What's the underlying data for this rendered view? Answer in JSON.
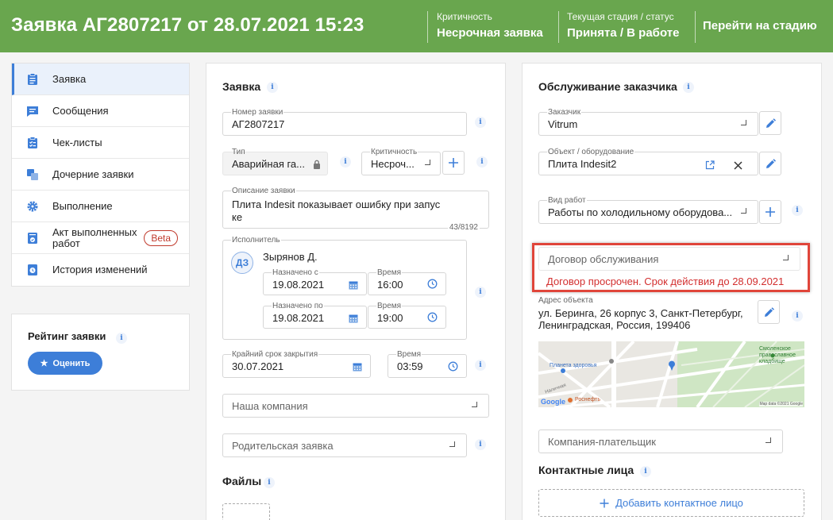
{
  "header": {
    "title": "Заявка АГ2807217 от 28.07.2021 15:23",
    "criticality_label": "Критичность",
    "criticality_value": "Несрочная заявка",
    "stage_label": "Текущая стадия / статус",
    "stage_value": "Принята / В работе",
    "goto_stage": "Перейти на стадию"
  },
  "sidebar": {
    "items": [
      {
        "label": "Заявка",
        "icon": "clipboard-icon"
      },
      {
        "label": "Сообщения",
        "icon": "message-icon"
      },
      {
        "label": "Чек-листы",
        "icon": "checklist-icon"
      },
      {
        "label": "Дочерние заявки",
        "icon": "child-requests-icon"
      },
      {
        "label": "Выполнение",
        "icon": "gear-icon"
      },
      {
        "label": "Акт выполненных работ",
        "icon": "act-icon",
        "badge": "Beta"
      },
      {
        "label": "История изменений",
        "icon": "history-icon"
      }
    ]
  },
  "rating": {
    "title": "Рейтинг заявки",
    "button": "Оценить"
  },
  "request": {
    "title": "Заявка",
    "number_label": "Номер заявки",
    "number_value": "АГ2807217",
    "type_label": "Тип",
    "type_value": "Аварийная га...",
    "crit_label": "Критичность",
    "crit_value": "Несроч...",
    "desc_label": "Описание заявки",
    "desc_value": "Плита Indesit показывает ошибку при запуске",
    "desc_line1": "Плита Indesit показывает ошибку при запус",
    "desc_line2": "ке",
    "desc_counter": "43/8192",
    "executor_label": "Исполнитель",
    "executor_initials": "ДЗ",
    "executor_name": "Зырянов Д.",
    "start_label": "Назначено с",
    "start_date": "19.08.2021",
    "start_time_label": "Время",
    "start_time": "16:00",
    "end_label": "Назначено по",
    "end_date": "19.08.2021",
    "end_time_label": "Время",
    "end_time": "19:00",
    "deadline_label": "Крайний срок закрытия",
    "deadline_date": "30.07.2021",
    "deadline_time_label": "Время",
    "deadline_time": "03:59",
    "our_company_placeholder": "Наша компания",
    "parent_placeholder": "Родительская заявка",
    "files_title": "Файлы"
  },
  "service": {
    "title": "Обслуживание заказчика",
    "customer_label": "Заказчик",
    "customer_value": "Vitrum",
    "object_label": "Объект / оборудование",
    "object_value": "Плита Indesit2",
    "work_label": "Вид работ",
    "work_value": "Работы по холодильному оборудова...",
    "contract_placeholder": "Договор обслуживания",
    "contract_error": "Договор просрочен. Срок действия до 28.09.2021",
    "address_label": "Адрес объекта",
    "address_line1": "ул. Беринга, 26 корпус 3, Санкт-Петербург,",
    "address_line2": "Ленинградская, Россия, 199406",
    "payer_placeholder": "Компания-плательщик",
    "contacts_title": "Контактные лица",
    "add_contact": "Добавить контактное лицо",
    "map": {
      "label_health": "Планета здоровья",
      "label_cemetery_1": "Смоленское",
      "label_cemetery_2": "православное",
      "label_cemetery_3": "кладбище",
      "label_rosneft": "Роснефть",
      "label_street": "Наличная",
      "google": "Google",
      "attribution": "Map data ©2021 Google"
    }
  },
  "colors": {
    "header": "#69a64e",
    "accent": "#3d7ed8",
    "error": "#e0453a"
  }
}
